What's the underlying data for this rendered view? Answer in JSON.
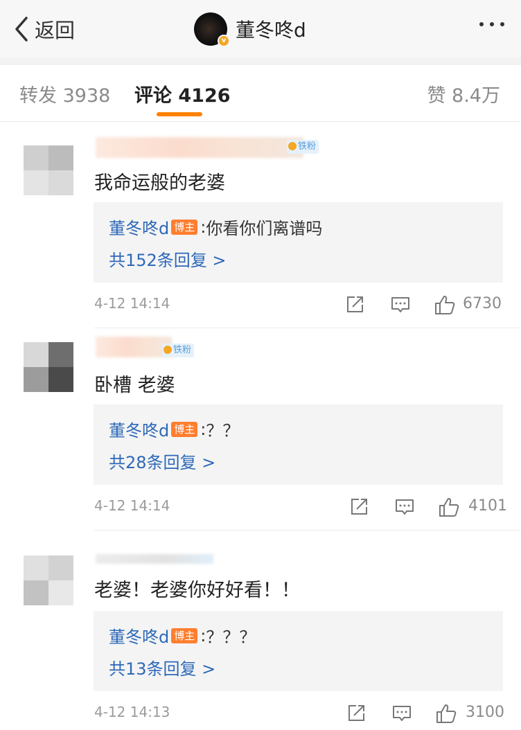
{
  "nav": {
    "back_label": "返回",
    "author_name": "董冬咚d",
    "verified_mark": "v"
  },
  "tabs": {
    "forward": "转发 3938",
    "comment": "评论 4126",
    "like": "赞 8.4万"
  },
  "badges": {
    "fan": "铁粉",
    "host": "博主"
  },
  "comments": [
    {
      "text": "我命运般的老婆",
      "reply": {
        "author": "董冬咚d",
        "colon": ":",
        "text": "你看你们离谱吗"
      },
      "reply_count": "共152条回复 >",
      "time": "4-12 14:14",
      "likes": "6730"
    },
    {
      "text": "卧槽 老婆",
      "reply": {
        "author": "董冬咚d",
        "colon": ":",
        "text": "？？"
      },
      "reply_count": "共28条回复 >",
      "time": "4-12 14:14",
      "likes": "4101"
    },
    {
      "text": "老婆！老婆你好好看！！",
      "reply": {
        "author": "董冬咚d",
        "colon": ":",
        "text": "？？？"
      },
      "reply_count": "共13条回复 >",
      "time": "4-12 14:13",
      "likes": "3100"
    }
  ],
  "icons": [
    "chevron-left-icon",
    "more-dots-icon",
    "repost-icon",
    "comment-icon",
    "thumbs-up-icon"
  ],
  "colors": {
    "accent": "#ff8200",
    "link": "#2d68b8",
    "host_badge": "#ff7e2f"
  }
}
